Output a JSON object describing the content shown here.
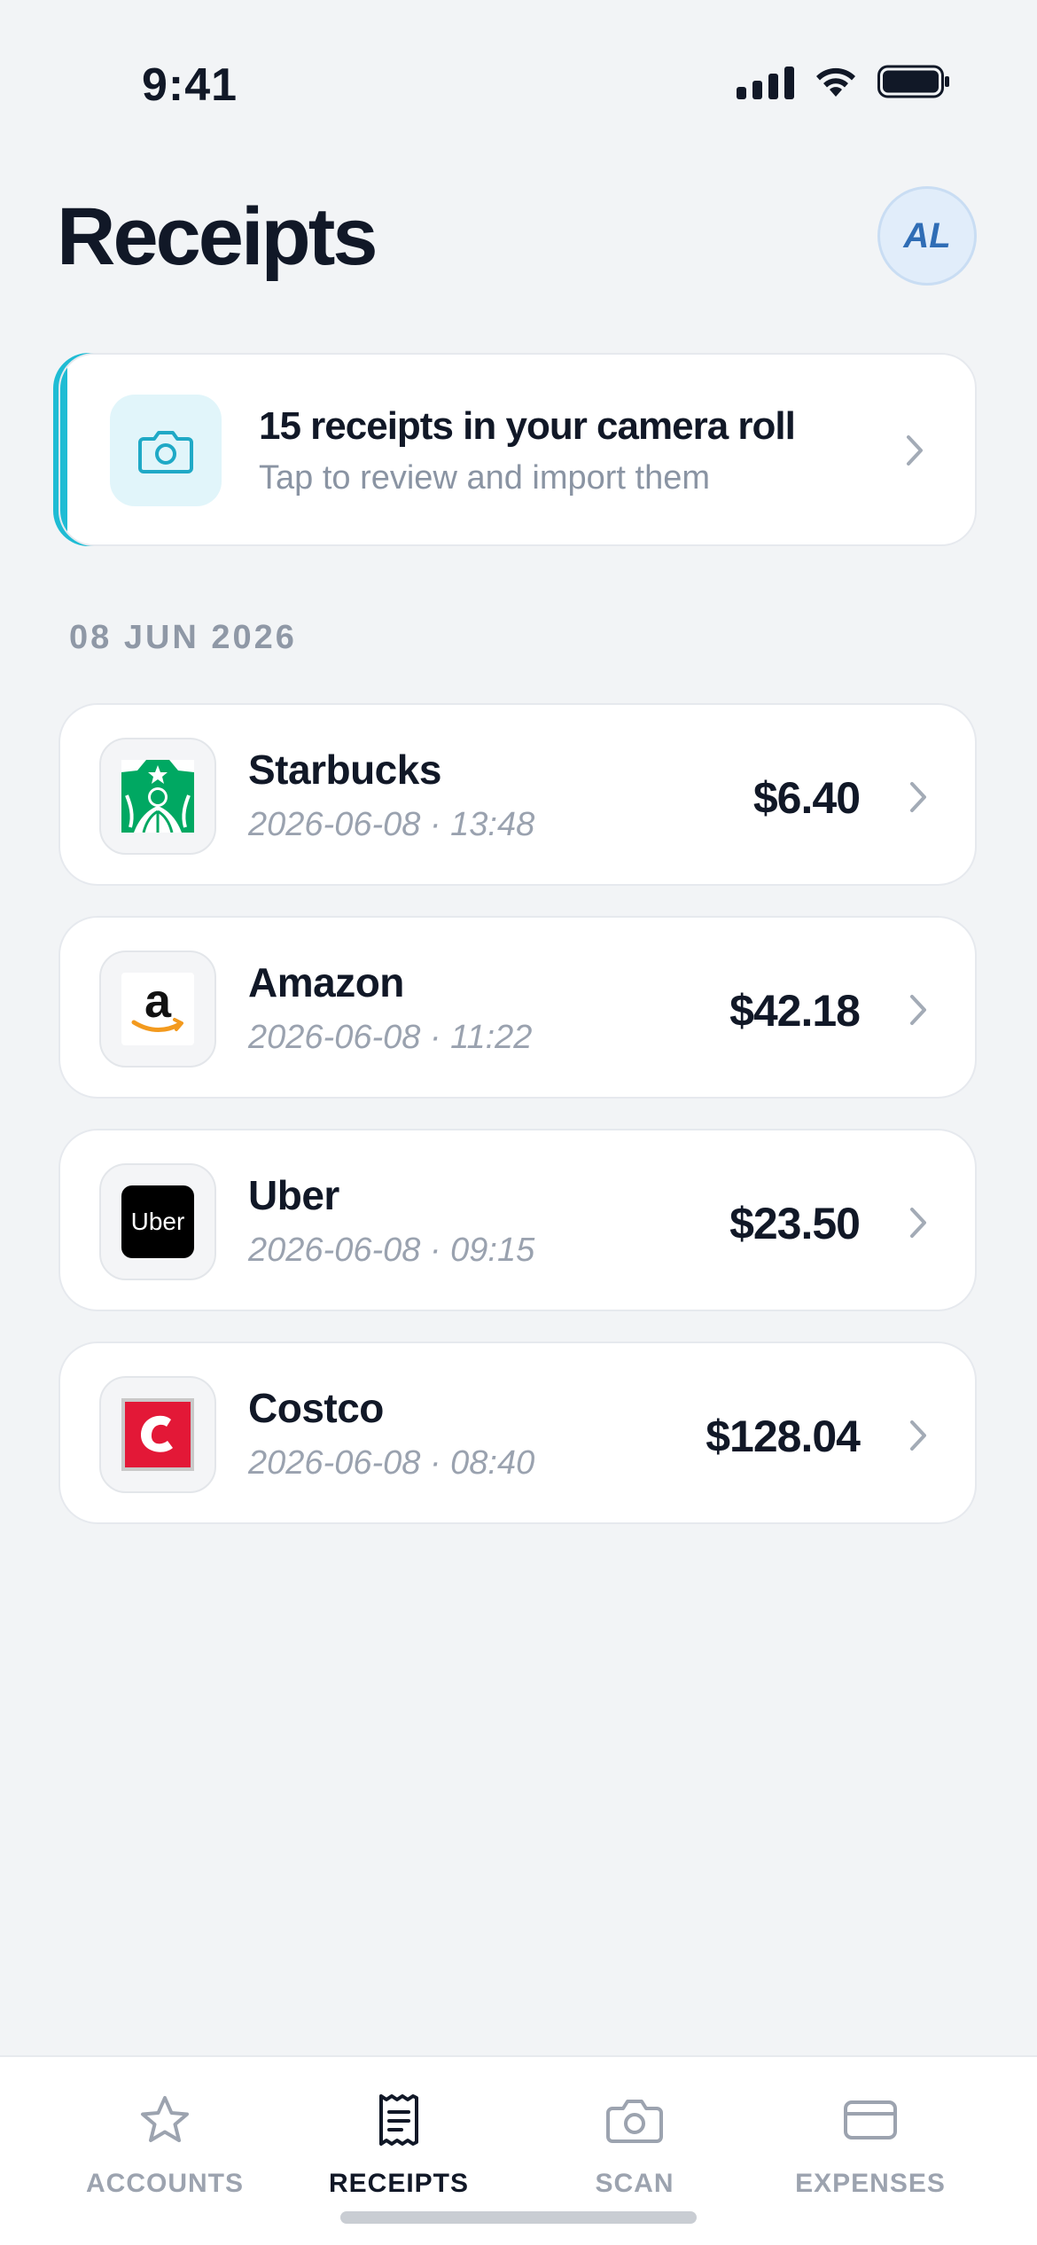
{
  "status_bar": {
    "time": "9:41"
  },
  "header": {
    "title": "Receipts",
    "avatar_initials": "AL"
  },
  "banner": {
    "title": "15 receipts in your camera roll",
    "subtitle": "Tap to review and import them",
    "icon": "camera-icon",
    "accent_color": "#1FBCD4"
  },
  "section": {
    "date_label": "08 JUN 2026"
  },
  "receipts": [
    {
      "merchant": "Starbucks",
      "datetime": "2026-06-08 · 13:48",
      "amount": "$6.40",
      "logo": "starbucks-logo"
    },
    {
      "merchant": "Amazon",
      "datetime": "2026-06-08 · 11:22",
      "amount": "$42.18",
      "logo": "amazon-logo"
    },
    {
      "merchant": "Uber",
      "datetime": "2026-06-08 · 09:15",
      "amount": "$23.50",
      "logo": "uber-logo",
      "logo_text": "Uber"
    },
    {
      "merchant": "Costco",
      "datetime": "2026-06-08 · 08:40",
      "amount": "$128.04",
      "logo": "costco-logo"
    }
  ],
  "tab_bar": {
    "tabs": [
      {
        "label": "ACCOUNTS",
        "icon": "star-icon",
        "active": false
      },
      {
        "label": "RECEIPTS",
        "icon": "receipt-icon",
        "active": true
      },
      {
        "label": "SCAN",
        "icon": "camera-icon",
        "active": false
      },
      {
        "label": "EXPENSES",
        "icon": "card-icon",
        "active": false
      }
    ]
  },
  "colors": {
    "background": "#F2F4F6",
    "accent": "#1FBCD4",
    "text_primary": "#111827",
    "text_muted": "#9AA2AF"
  }
}
